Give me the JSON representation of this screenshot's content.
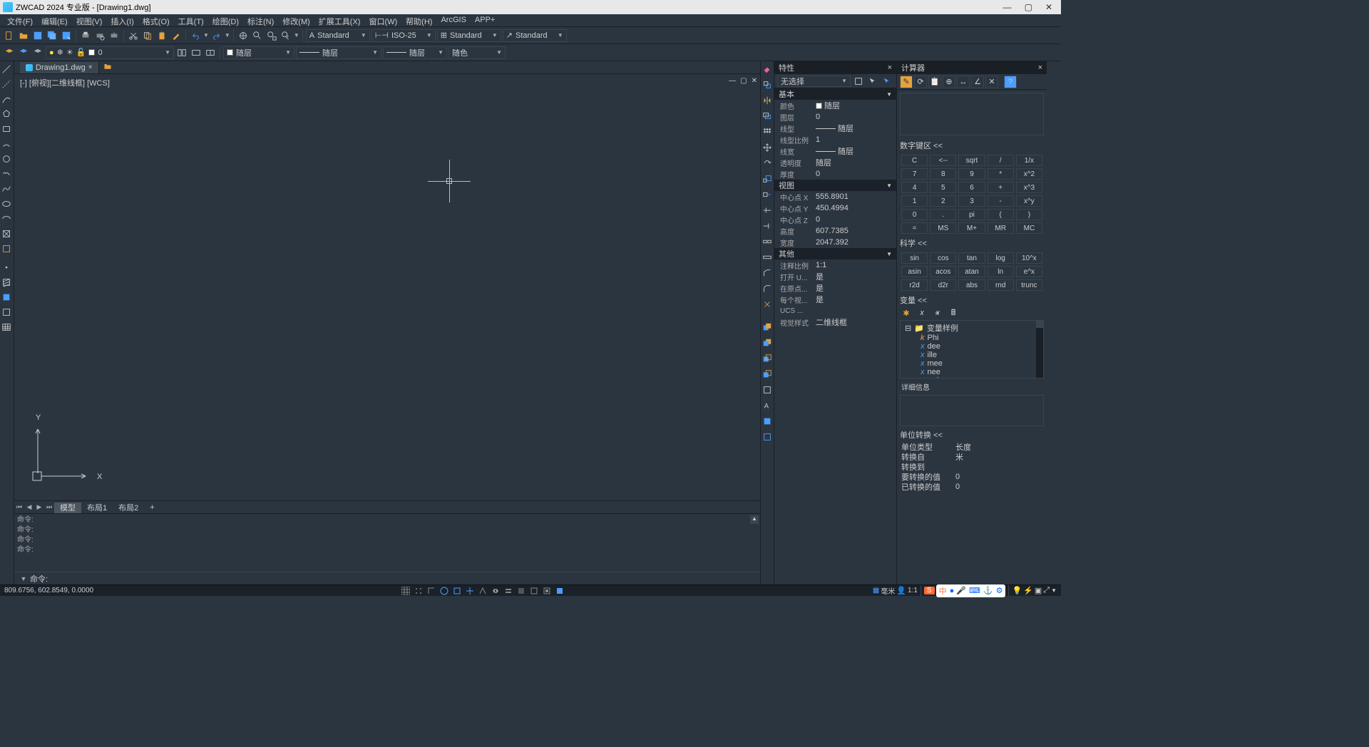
{
  "titlebar": {
    "title": "ZWCAD 2024 专业版 - [Drawing1.dwg]"
  },
  "menus": [
    "文件(F)",
    "编辑(E)",
    "视图(V)",
    "插入(I)",
    "格式(O)",
    "工具(T)",
    "绘图(D)",
    "标注(N)",
    "修改(M)",
    "扩展工具(X)",
    "窗口(W)",
    "帮助(H)",
    "ArcGIS",
    "APP+"
  ],
  "toolbar1_combos": {
    "style1": "Standard",
    "dimstyle": "ISO-25",
    "tblstyle": "Standard",
    "mlstyle": "Standard"
  },
  "toolbar2": {
    "layer_value": "0",
    "layer_combo": "随层",
    "ltype": "随层",
    "lweight": "随层",
    "color": "随色"
  },
  "doc": {
    "tab": "Drawing1.dwg",
    "corner_label": "[-] [俯视][二维线框] [WCS]"
  },
  "layout_tabs": [
    "模型",
    "布局1",
    "布局2"
  ],
  "cmd": {
    "history": [
      "命令:",
      "命令:",
      "命令:",
      "命令:"
    ],
    "prompt": "命令:"
  },
  "props": {
    "title": "特性",
    "selection": "无选择",
    "sec_basic": "基本",
    "sec_view": "视图",
    "sec_other": "其他",
    "rows_basic": [
      {
        "l": "颜色",
        "v": "随层",
        "swatch": "#fff"
      },
      {
        "l": "图层",
        "v": "0"
      },
      {
        "l": "线型",
        "v": "随层",
        "line": true
      },
      {
        "l": "线型比例",
        "v": "1"
      },
      {
        "l": "线宽",
        "v": "随层",
        "line": true
      },
      {
        "l": "透明度",
        "v": "随层"
      },
      {
        "l": "厚度",
        "v": "0"
      }
    ],
    "rows_view": [
      {
        "l": "中心点 X",
        "v": "555.8901"
      },
      {
        "l": "中心点 Y",
        "v": "450.4994"
      },
      {
        "l": "中心点 Z",
        "v": "0"
      },
      {
        "l": "高度",
        "v": "607.7385"
      },
      {
        "l": "宽度",
        "v": "2047.392"
      }
    ],
    "rows_other": [
      {
        "l": "注释比例",
        "v": "1:1"
      },
      {
        "l": "打开 U...",
        "v": "是"
      },
      {
        "l": "在原点...",
        "v": "是"
      },
      {
        "l": "每个视...",
        "v": "是"
      },
      {
        "l": "UCS ...",
        "v": ""
      },
      {
        "l": "视觉样式",
        "v": "二维线框"
      }
    ]
  },
  "calc": {
    "title": "计算器",
    "sec_num": "数字键区 <<",
    "num_keys": [
      [
        "C",
        "<--",
        "sqrt",
        "/",
        "1/x"
      ],
      [
        "7",
        "8",
        "9",
        "*",
        "x^2"
      ],
      [
        "4",
        "5",
        "6",
        "+",
        "x^3"
      ],
      [
        "1",
        "2",
        "3",
        "-",
        "x^y"
      ],
      [
        "0",
        ".",
        "pi",
        "(",
        ")"
      ],
      [
        "=",
        "MS",
        "M+",
        "MR",
        "MC"
      ]
    ],
    "sec_sci": "科学 <<",
    "sci_keys": [
      [
        "sin",
        "cos",
        "tan",
        "log",
        "10^x"
      ],
      [
        "asin",
        "acos",
        "atan",
        "ln",
        "e^x"
      ],
      [
        "r2d",
        "d2r",
        "abs",
        "rnd",
        "trunc"
      ]
    ],
    "sec_var": "变量 <<",
    "var_root": "变量样例",
    "vars": [
      {
        "t": "k",
        "n": "Phi"
      },
      {
        "t": "x",
        "n": "dee"
      },
      {
        "t": "x",
        "n": "ille"
      },
      {
        "t": "x",
        "n": "mee"
      },
      {
        "t": "x",
        "n": "nee"
      },
      {
        "t": "x",
        "n": "rad"
      }
    ],
    "detail_hdr": "详细信息",
    "sec_unit": "单位转换 <<",
    "unit_rows": [
      {
        "l": "单位类型",
        "v": "长度"
      },
      {
        "l": "转换自",
        "v": "米"
      },
      {
        "l": "转换到",
        "v": ""
      },
      {
        "l": "要转换的值",
        "v": "0"
      },
      {
        "l": "已转换的值",
        "v": "0"
      }
    ]
  },
  "status": {
    "coords": "809.6756, 602.8549, 0.0000",
    "mid_right": {
      "units": "毫米",
      "person": "",
      "scale": "1:1"
    }
  }
}
